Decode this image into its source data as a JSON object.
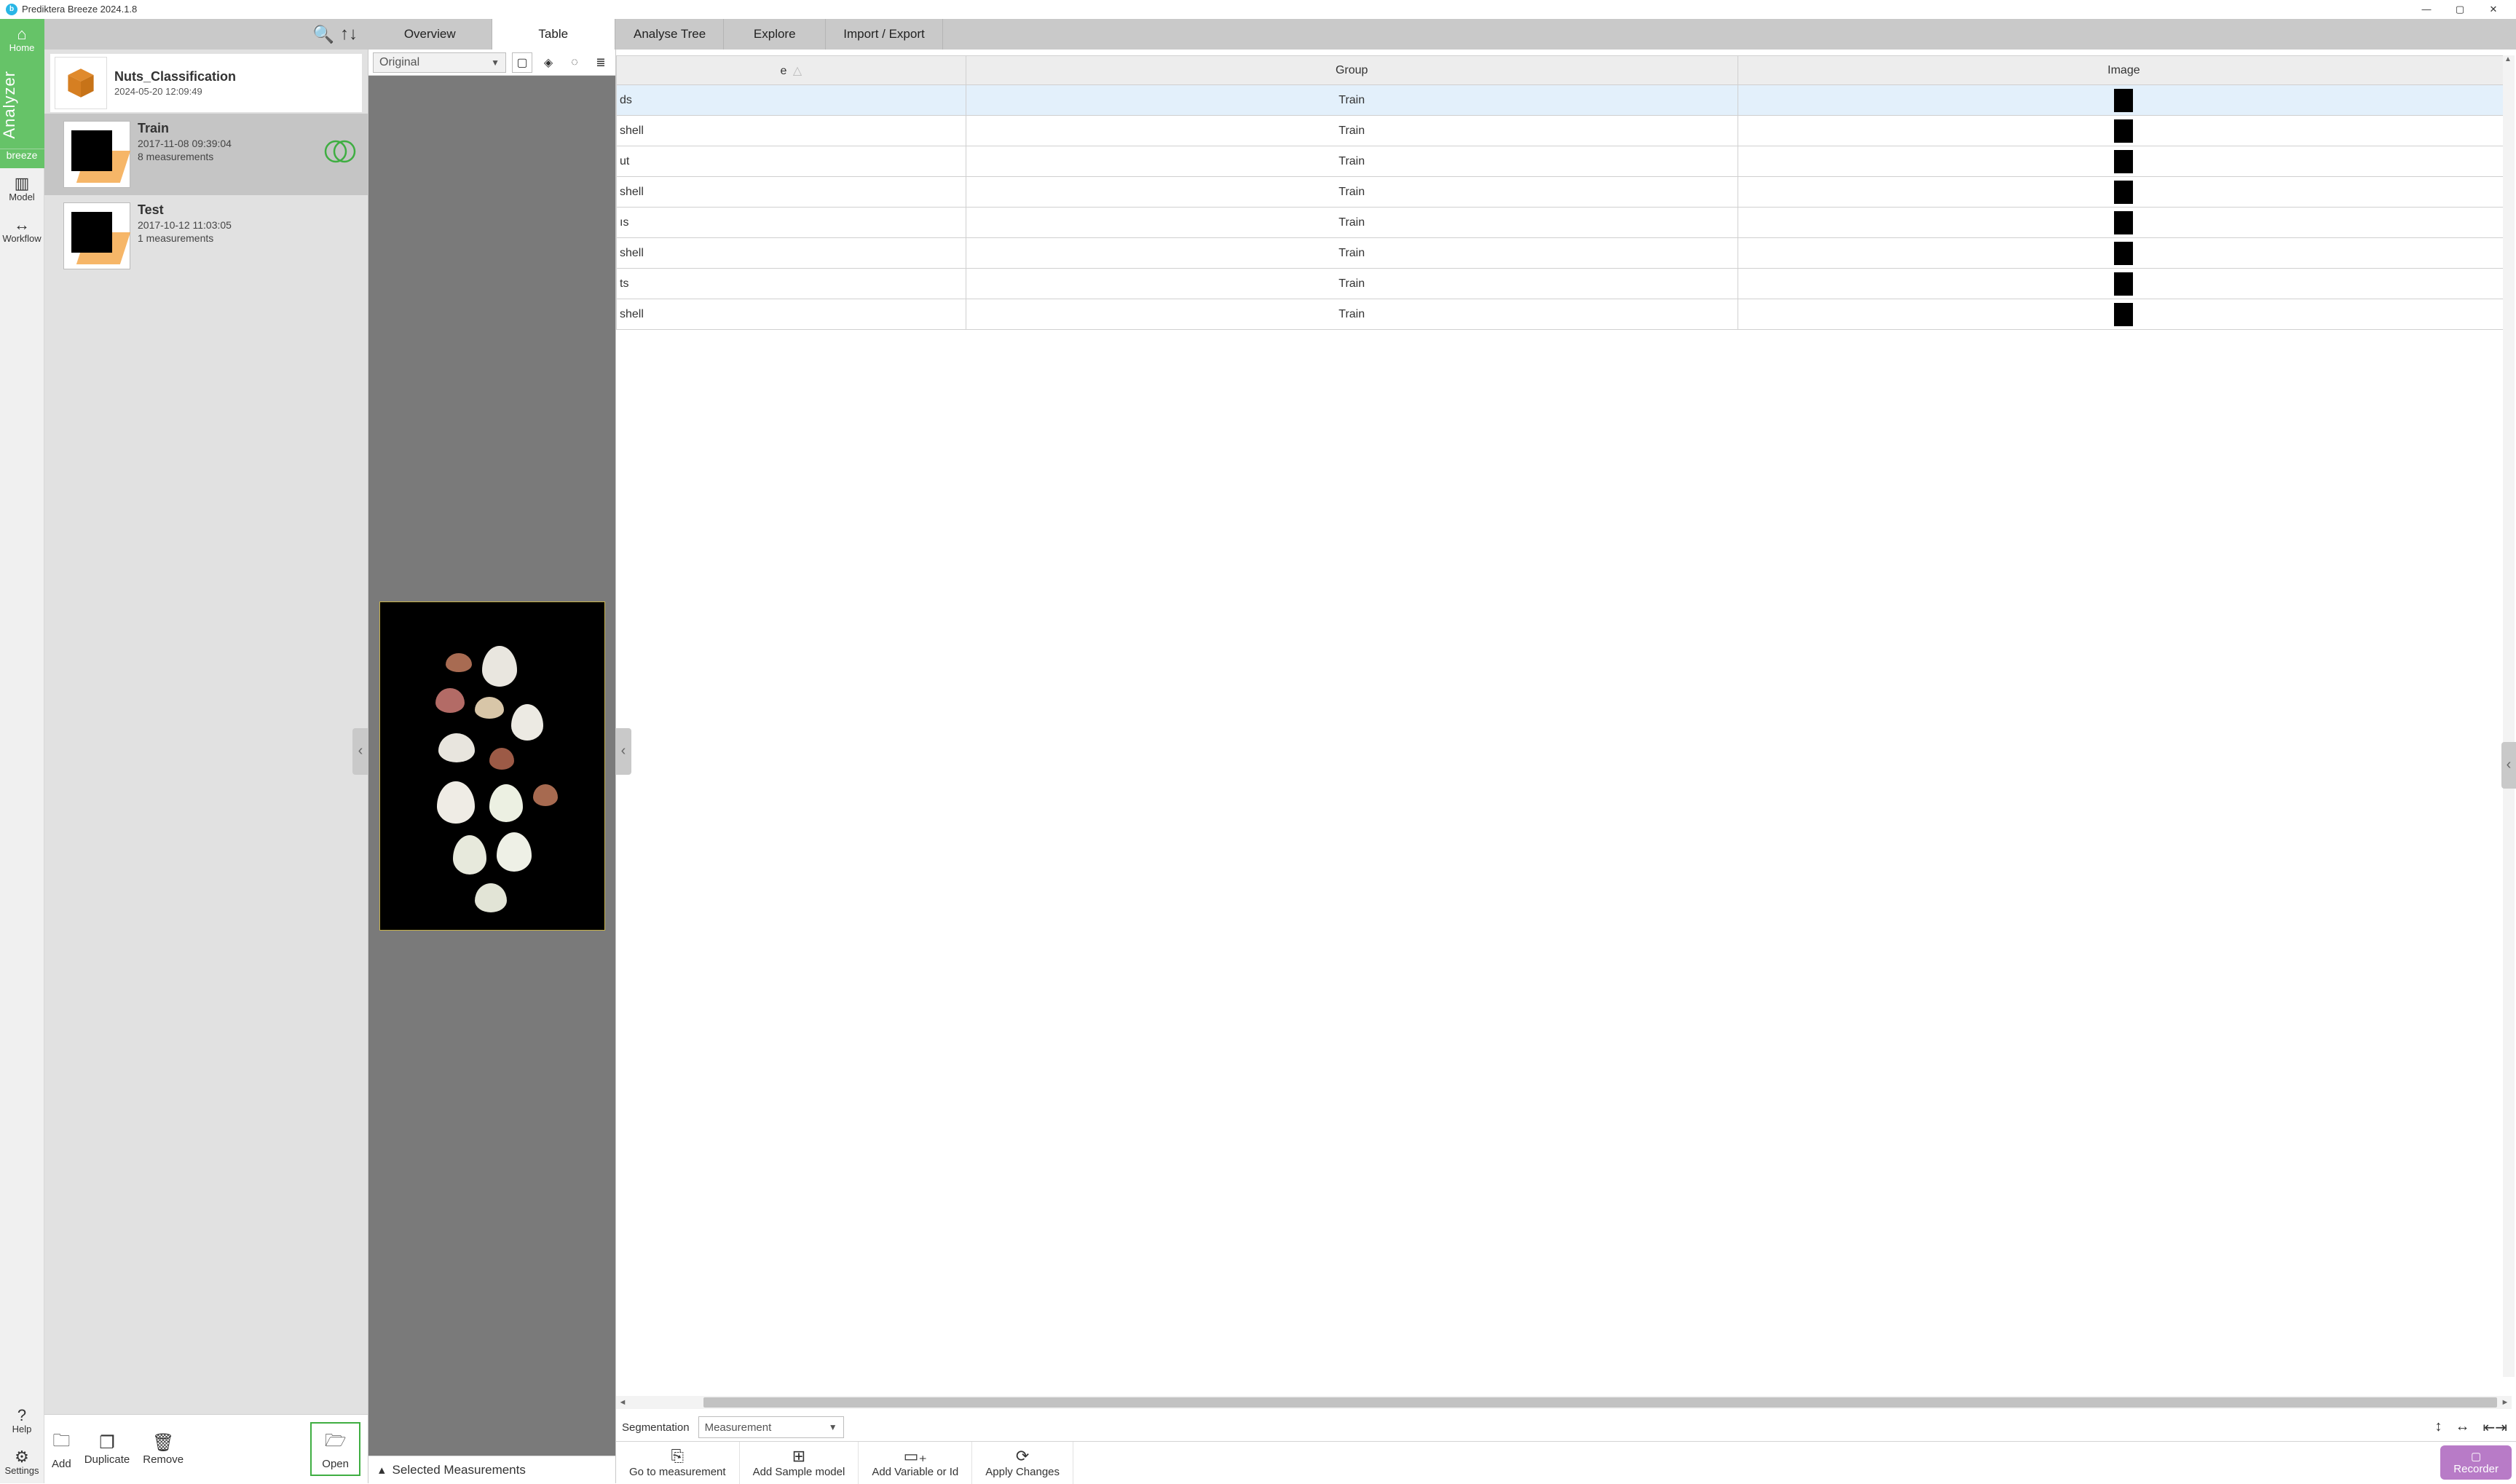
{
  "window": {
    "title": "Prediktera Breeze 2024.1.8"
  },
  "far_left": {
    "home": "Home",
    "analyzer": "Analyzer",
    "breeze": "breeze",
    "model": "Model",
    "workflow": "Workflow",
    "help": "Help",
    "settings": "Settings"
  },
  "project": {
    "name": "Nuts_Classification",
    "date": "2024-05-20 12:09:49"
  },
  "datasets": [
    {
      "name": "Train",
      "date": "2017-11-08 09:39:04",
      "meas": "8 measurements"
    },
    {
      "name": "Test",
      "date": "2017-10-12 11:03:05",
      "meas": "1 measurements"
    }
  ],
  "lp_actions": {
    "add": "Add",
    "duplicate": "Duplicate",
    "remove": "Remove",
    "open": "Open"
  },
  "center": {
    "tabs": [
      "Overview",
      "Table"
    ],
    "dropdown_label": "Original",
    "selected_meas": "Selected Measurements"
  },
  "right_tabs": [
    "Analyse Tree",
    "Explore",
    "Import / Export"
  ],
  "table": {
    "headers": [
      "e",
      "Group",
      "Image"
    ],
    "rows": [
      {
        "c0": "ds",
        "group": "Train"
      },
      {
        "c0": "shell",
        "group": "Train"
      },
      {
        "c0": "ut",
        "group": "Train"
      },
      {
        "c0": " shell",
        "group": "Train"
      },
      {
        "c0": "ıs",
        "group": "Train"
      },
      {
        "c0": "shell",
        "group": "Train"
      },
      {
        "c0": "ts",
        "group": "Train"
      },
      {
        "c0": " shell",
        "group": "Train"
      }
    ]
  },
  "segmentation": {
    "label": "Segmentation",
    "value": "Measurement"
  },
  "bottom_actions": {
    "goto": "Go to measurement",
    "add_sample": "Add Sample model",
    "add_var": "Add Variable or Id",
    "apply": "Apply Changes",
    "recorder": "Recorder"
  }
}
